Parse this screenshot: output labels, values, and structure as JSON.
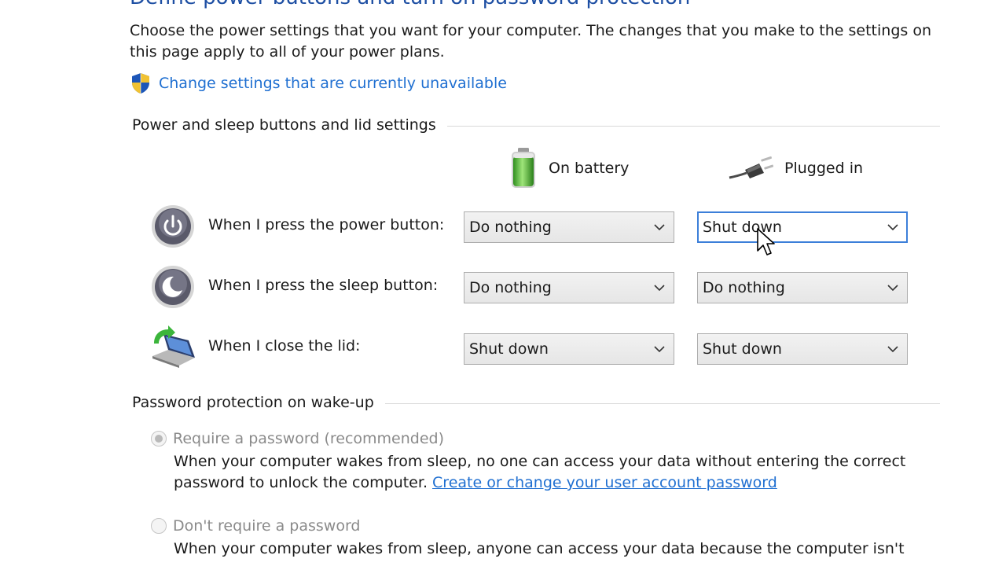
{
  "page": {
    "title": "Define power buttons and turn on password protection",
    "intro": "Choose the power settings that you want for your computer. The changes that you make to the settings on this page apply to all of your power plans.",
    "admin_link": "Change settings that are currently unavailable"
  },
  "buttons_section": {
    "header": "Power and sleep buttons and lid settings",
    "columns": {
      "battery": "On battery",
      "plugged": "Plugged in"
    },
    "rows": [
      {
        "label": "When I press the power button:",
        "battery": "Do nothing",
        "plugged": "Shut down",
        "icon": "power-icon"
      },
      {
        "label": "When I press the sleep button:",
        "battery": "Do nothing",
        "plugged": "Do nothing",
        "icon": "sleep-icon"
      },
      {
        "label": "When I close the lid:",
        "battery": "Shut down",
        "plugged": "Shut down",
        "icon": "laptop-lid-icon"
      }
    ]
  },
  "password_section": {
    "header": "Password protection on wake-up",
    "require": {
      "label": "Require a password (recommended)",
      "desc": "When your computer wakes from sleep, no one can access your data without entering the correct password to unlock the computer.",
      "link": "Create or change your user account password",
      "selected": true
    },
    "no_require": {
      "label": "Don't require a password",
      "desc": "When your computer wakes from sleep, anyone can access your data because the computer isn't",
      "selected": false
    }
  },
  "colors": {
    "link": "#1f6fd1",
    "title": "#1e4fa3",
    "focus": "#3c7fd9"
  }
}
